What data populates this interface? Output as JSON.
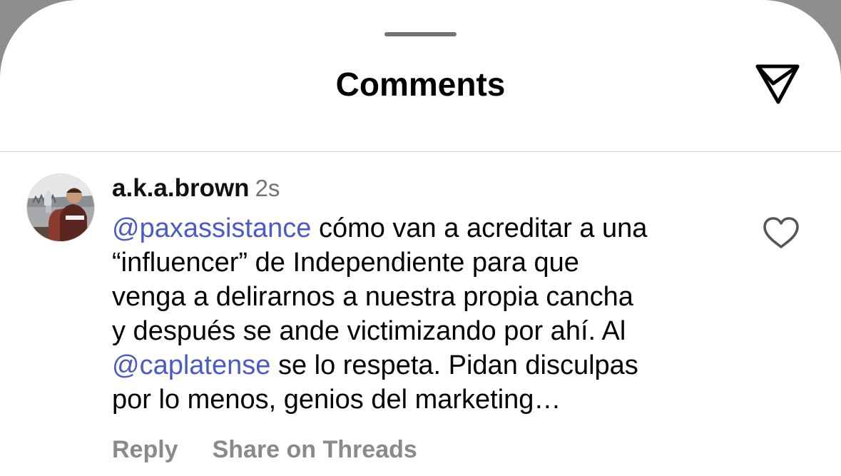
{
  "sheet": {
    "title": "Comments",
    "share_icon": "paper-plane-icon"
  },
  "comment": {
    "username": "a.k.a.brown",
    "timestamp": "2s",
    "lines": [
      [
        {
          "text": "@paxassistance",
          "mention": true
        },
        {
          "text": " cómo van a acreditar a una",
          "mention": false
        }
      ],
      [
        {
          "text": "“influencer” de Independiente para que",
          "mention": false
        }
      ],
      [
        {
          "text": "venga a delirarnos a nuestra propia cancha",
          "mention": false
        }
      ],
      [
        {
          "text": "y después se ande victimizando por ahí. Al",
          "mention": false
        }
      ],
      [
        {
          "text": "@caplatense",
          "mention": true
        },
        {
          "text": " se lo respeta. Pidan disculpas",
          "mention": false
        }
      ],
      [
        {
          "text": "por lo menos, genios del marketing…",
          "mention": false
        }
      ]
    ],
    "like_icon": "heart-outline-icon",
    "actions": {
      "reply": "Reply",
      "share_threads": "Share on Threads"
    }
  },
  "colors": {
    "mention": "#4a5bc7",
    "secondary_text": "#737373",
    "action_text": "#8a8a8a"
  }
}
